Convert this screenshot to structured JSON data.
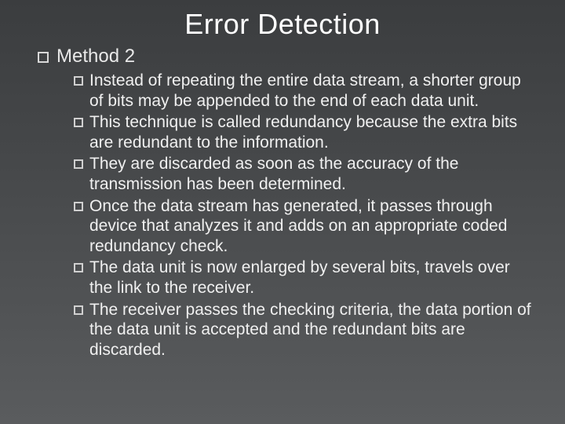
{
  "title": "Error Detection",
  "heading": "Method 2",
  "bullets": [
    "Instead of repeating the entire data stream, a shorter group of bits may be appended to the end of each data unit.",
    "This technique is called redundancy because the extra bits are redundant to the information.",
    "They are discarded as soon as the accuracy of the transmission has been determined.",
    "Once the data stream has generated, it passes through device that analyzes it and adds on an appropriate coded redundancy check.",
    "The data unit is now enlarged by several bits, travels over the link to the receiver.",
    "The receiver passes the checking criteria, the data portion of the data unit is accepted and the redundant bits are discarded."
  ]
}
